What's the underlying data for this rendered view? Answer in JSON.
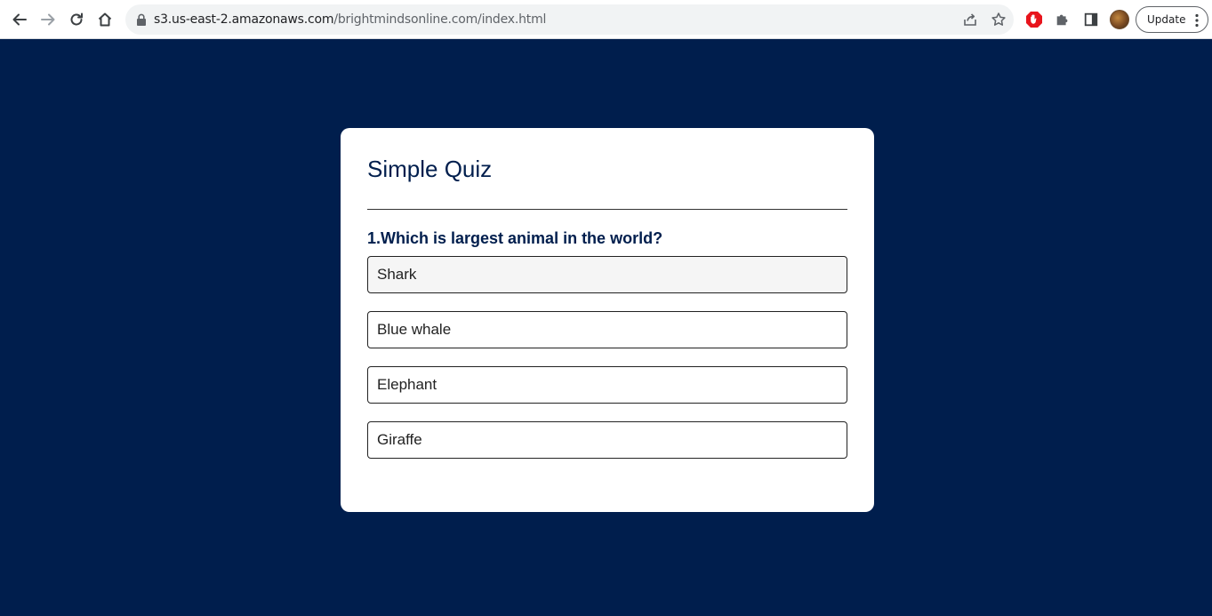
{
  "browser": {
    "url_host": "s3.us-east-2.amazonaws.com",
    "url_path": "/brightmindsonline.com/index.html",
    "update_label": "Update",
    "icons": [
      "back-arrow-icon",
      "forward-arrow-icon",
      "reload-icon",
      "home-icon",
      "lock-icon",
      "share-icon",
      "bookmark-star-icon",
      "adblock-icon",
      "extensions-puzzle-icon",
      "side-panel-icon",
      "profile-avatar",
      "kebab-menu-icon"
    ]
  },
  "quiz": {
    "title": "Simple Quiz",
    "question": "1.Which is largest animal in the world?",
    "answers": [
      {
        "label": "Shark",
        "state": "hover"
      },
      {
        "label": "Blue whale",
        "state": "normal"
      },
      {
        "label": "Elephant",
        "state": "normal"
      },
      {
        "label": "Giraffe",
        "state": "normal"
      }
    ]
  },
  "colors": {
    "page_background": "#001e4d",
    "card_background": "#ffffff",
    "title_text": "#001e4d",
    "answer_border": "#222222",
    "answer_hover_background": "#f5f5f5",
    "adblock_red": "#e8141c"
  }
}
